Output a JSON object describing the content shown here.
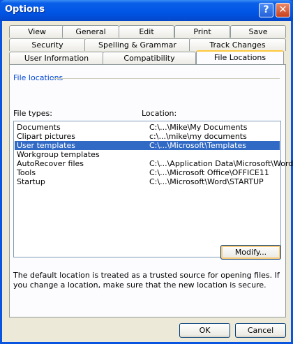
{
  "window": {
    "title": "Options"
  },
  "titlebar_buttons": {
    "help": "?",
    "close": "✕"
  },
  "tabs": {
    "row1": [
      "View",
      "General",
      "Edit",
      "Print",
      "Save"
    ],
    "row2": [
      "Security",
      "Spelling & Grammar",
      "Track Changes"
    ],
    "row3": [
      "User Information",
      "Compatibility",
      "File Locations"
    ],
    "active": "File Locations"
  },
  "group": {
    "label": "File locations"
  },
  "columns": {
    "file_types": "File types:",
    "location": "Location:"
  },
  "rows": [
    {
      "type": "Documents",
      "location": "C:\\...\\Mike\\My Documents",
      "selected": false
    },
    {
      "type": "Clipart pictures",
      "location": "c:\\...\\mike\\my documents",
      "selected": false
    },
    {
      "type": "User templates",
      "location": "C:\\...\\Microsoft\\Templates",
      "selected": true
    },
    {
      "type": "Workgroup templates",
      "location": "",
      "selected": false
    },
    {
      "type": "AutoRecover files",
      "location": "C:\\...\\Application Data\\Microsoft\\Word",
      "selected": false
    },
    {
      "type": "Tools",
      "location": "C:\\...\\Microsoft Office\\OFFICE11",
      "selected": false
    },
    {
      "type": "Startup",
      "location": "C:\\...\\Microsoft\\Word\\STARTUP",
      "selected": false
    }
  ],
  "buttons": {
    "modify": "Modify...",
    "ok": "OK",
    "cancel": "Cancel"
  },
  "note": "The default location is treated as a trusted source for opening files. If you change a location, make sure that the new location is secure.",
  "colors": {
    "titlebar": "#0055e5",
    "selection": "#316ac5",
    "dialog_bg": "#ece9d8",
    "group_label": "#0046d5"
  }
}
